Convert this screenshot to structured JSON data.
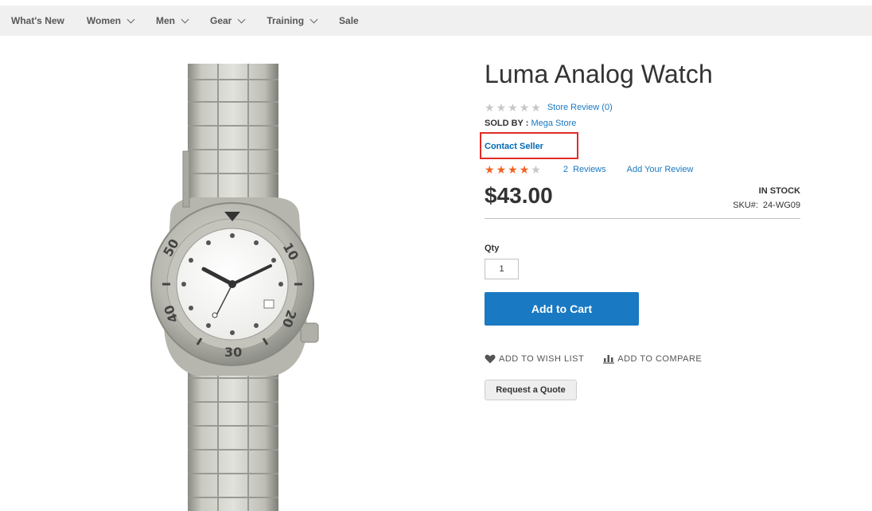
{
  "nav": {
    "items": [
      {
        "label": "What's New",
        "has_dropdown": false
      },
      {
        "label": "Women",
        "has_dropdown": true
      },
      {
        "label": "Men",
        "has_dropdown": true
      },
      {
        "label": "Gear",
        "has_dropdown": true
      },
      {
        "label": "Training",
        "has_dropdown": true
      },
      {
        "label": "Sale",
        "has_dropdown": false
      }
    ]
  },
  "product": {
    "title": "Luma Analog Watch",
    "store_review_link": "Store Review (0)",
    "sold_by_label": "SOLD BY :",
    "seller_name": "Mega Store",
    "contact_seller": "Contact Seller",
    "rating_stars_filled": 4,
    "rating_stars_total": 5,
    "reviews_count": "2",
    "reviews_label": "Reviews",
    "add_review": "Add Your Review",
    "price": "$43.00",
    "stock": "IN STOCK",
    "sku_label": "SKU#:",
    "sku_value": "24-WG09",
    "qty_label": "Qty",
    "qty_value": "1",
    "add_to_cart": "Add to Cart",
    "wish_list": "ADD TO WISH LIST",
    "compare": "ADD TO COMPARE",
    "request_quote": "Request a Quote"
  },
  "colors": {
    "accent_blue": "#1979c3",
    "rating_orange": "#f26322",
    "highlight_red": "#e02b27",
    "nav_bg": "#f0f0f0"
  }
}
